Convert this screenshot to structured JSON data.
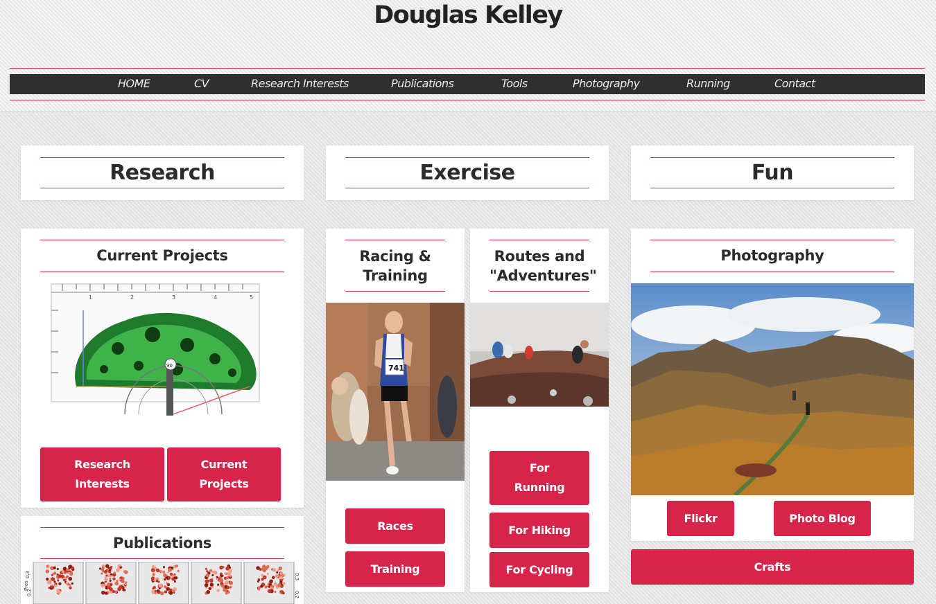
{
  "site": {
    "title": "Douglas Kelley"
  },
  "nav": {
    "items": [
      "HOME",
      "CV",
      "Research Interests",
      "Publications",
      "Tools",
      "Photography",
      "Running",
      "Contact"
    ]
  },
  "sections": {
    "research": "Research",
    "exercise": "Exercise",
    "fun": "Fun"
  },
  "cards": {
    "current_projects": {
      "title": "Current Projects",
      "buttons": [
        "Research Interests",
        "Current Projects"
      ]
    },
    "publications": {
      "title": "Publications"
    },
    "racing": {
      "title": "Racing & Training",
      "buttons": [
        "Races",
        "Training"
      ]
    },
    "routes": {
      "title": "Routes and \"Adventures\"",
      "buttons": [
        "For Running",
        "For Hiking",
        "For Cycling"
      ]
    },
    "photography": {
      "title": "Photography",
      "buttons": [
        "Flickr",
        "Photo Blog"
      ]
    },
    "crafts": {
      "label": "Crafts"
    }
  },
  "images": {
    "runner_bib": "741",
    "ruler_marks": [
      "1",
      "2",
      "3",
      "4",
      "5"
    ],
    "protractor_mark": "90",
    "plot_axis": [
      "0.3",
      "0.2"
    ],
    "plot_ylabel": "Pres"
  },
  "colors": {
    "accent": "#d6244a",
    "nav_bg": "#2f2f2f"
  }
}
